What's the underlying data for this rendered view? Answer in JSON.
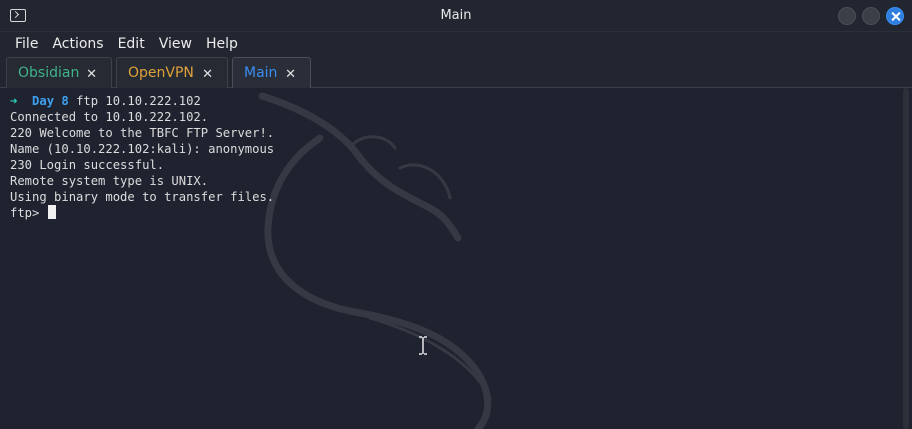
{
  "window": {
    "title": "Main"
  },
  "menu": [
    "File",
    "Actions",
    "Edit",
    "View",
    "Help"
  ],
  "tabs": [
    {
      "label": "Obsidian",
      "color": "#3fb38a",
      "close": "✕"
    },
    {
      "label": "OpenVPN",
      "color": "#e0a23a",
      "close": "✕"
    },
    {
      "label": "Main",
      "color": "#3b8ef0",
      "close": "✕",
      "active": true
    }
  ],
  "terminal": {
    "prompt_arrow": "➜",
    "prompt_dir": "Day 8",
    "command": "ftp 10.10.222.102",
    "lines": [
      "Connected to 10.10.222.102.",
      "220 Welcome to the TBFC FTP Server!.",
      "Name (10.10.222.102:kali): anonymous",
      "230 Login successful.",
      "Remote system type is UNIX.",
      "Using binary mode to transfer files."
    ],
    "current_prompt": "ftp>"
  }
}
